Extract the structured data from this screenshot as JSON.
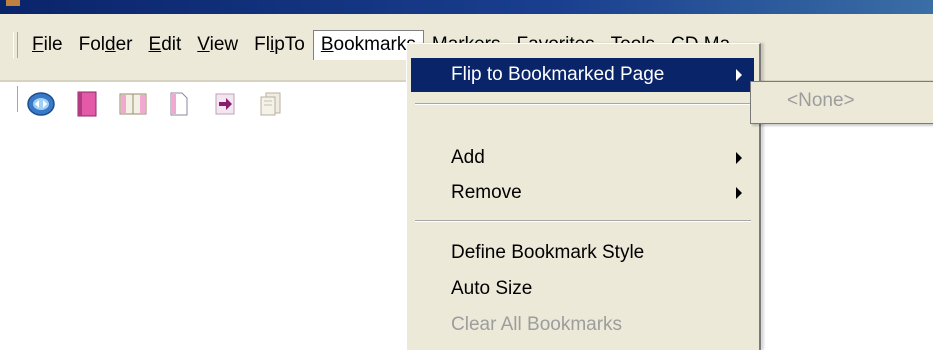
{
  "menubar": {
    "items": [
      {
        "pre": "",
        "u": "F",
        "post": "ile"
      },
      {
        "pre": "Fol",
        "u": "d",
        "post": "er"
      },
      {
        "pre": "",
        "u": "E",
        "post": "dit"
      },
      {
        "pre": "",
        "u": "V",
        "post": "iew"
      },
      {
        "pre": "Fl",
        "u": "i",
        "post": "pTo"
      },
      {
        "pre": "",
        "u": "B",
        "post": "ookmarks"
      },
      {
        "pre": "",
        "u": "M",
        "post": "arkers"
      },
      {
        "pre": "Favo",
        "u": "r",
        "post": "ites"
      },
      {
        "pre": "",
        "u": "T",
        "post": "ools"
      },
      {
        "pre": "CD ",
        "u": "Ma",
        "post": ""
      }
    ]
  },
  "toolbar": {
    "icons": [
      "globe-icon",
      "notebook-icon",
      "open-book-icon",
      "page-icon",
      "arrow-right-icon",
      "stacked-pages-icon"
    ]
  },
  "dropdown": {
    "flip_label": "Flip to Bookmarked Page",
    "add_label": "Add",
    "remove_label": "Remove",
    "define_label": "Define Bookmark Style",
    "autosize_label": "Auto Size",
    "clear_label": "Clear All Bookmarks"
  },
  "submenu": {
    "none_label": "<None>"
  },
  "colors": {
    "menu_bg": "#ece9d8",
    "highlight": "#0a246a",
    "disabled_text": "#9d9d9d",
    "titlebar": "#0a246a"
  }
}
